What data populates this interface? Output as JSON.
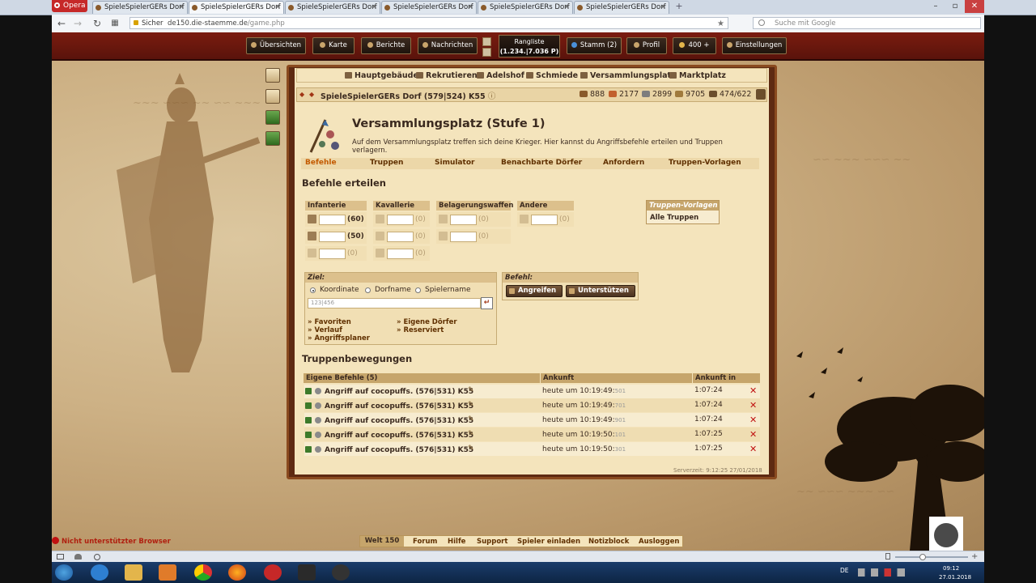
{
  "browser": {
    "opera_label": "Opera",
    "tabs": [
      {
        "title": "SpieleSpielerGERs Dorf ...",
        "active": false
      },
      {
        "title": "SpieleSpielerGERs Dorf ...",
        "active": true
      },
      {
        "title": "SpieleSpielerGERs Dorf ...",
        "active": false
      },
      {
        "title": "SpieleSpielerGERs Dorf ...",
        "active": false
      },
      {
        "title": "SpieleSpielerGERs Dorf ...",
        "active": false
      },
      {
        "title": "SpieleSpielerGERs Dorf ...",
        "active": false
      }
    ],
    "secure_label": "Sicher",
    "url_domain": "de150.die-staemme.de",
    "url_path": "/game.php",
    "search_placeholder": "Suche mit Google",
    "new_tab": "+"
  },
  "topmenu": {
    "uebersichten": "Übersichten",
    "karte": "Karte",
    "berichte": "Berichte",
    "nachrichten": "Nachrichten",
    "rangliste_label": "Rangliste",
    "rangliste_value": "(1.234.|7.036 P)",
    "stamm": "Stamm (2)",
    "profil": "Profil",
    "premium": "400 +",
    "einstellungen": "Einstellungen"
  },
  "buildings": {
    "hauptgebaeude": "Hauptgebäude",
    "rekrutieren": "Rekrutieren",
    "adelshof": "Adelshof",
    "schmiede": "Schmiede",
    "versammlungsplatz": "Versammlungsplatz",
    "marktplatz": "Marktplatz"
  },
  "village": {
    "name": "SpieleSpielerGERs Dorf (579|524) K55",
    "wood": "888",
    "clay": "2177",
    "iron": "2899",
    "storage": "9705",
    "population": "474/622"
  },
  "page": {
    "title": "Versammlungsplatz (Stufe 1)",
    "description": "Auf dem Versammlungsplatz treffen sich deine Krieger. Hier kannst du Angriffsbefehle erteilen und Truppen verlagern.",
    "subtabs": [
      "Befehle",
      "Truppen",
      "Simulator",
      "Benachbarte Dörfer",
      "Anfordern",
      "Truppen-Vorlagen"
    ],
    "selected_subtab": "Befehle",
    "befehle_heading": "Befehle erteilen"
  },
  "units": {
    "infanterie": "Infanterie",
    "kavallerie": "Kavallerie",
    "belagerung": "Belagerungswaffen",
    "andere": "Andere",
    "inf": [
      {
        "icon": "spear-icon",
        "count": "(60)",
        "available": true
      },
      {
        "icon": "sword-icon",
        "count": "(50)",
        "available": true
      },
      {
        "icon": "axe-icon",
        "count": "(0)",
        "available": false
      }
    ],
    "kav": [
      {
        "icon": "scout-icon",
        "count": "(0)"
      },
      {
        "icon": "light-cavalry-icon",
        "count": "(0)"
      },
      {
        "icon": "heavy-cavalry-icon",
        "count": "(0)"
      }
    ],
    "bel": [
      {
        "icon": "ram-icon",
        "count": "(0)"
      },
      {
        "icon": "catapult-icon",
        "count": "(0)"
      }
    ],
    "and": [
      {
        "icon": "noble-icon",
        "count": "(0)"
      }
    ]
  },
  "templates": {
    "head": "Truppen-Vorlagen",
    "all": "Alle Truppen"
  },
  "ziel": {
    "head": "Ziel:",
    "opt_coord": "Koordinate",
    "opt_village": "Dorfname",
    "opt_player": "Spielername",
    "input_placeholder": "123|456",
    "link_favoriten": "» Favoriten",
    "link_verlauf": "» Verlauf",
    "link_angriffsplaner": "» Angriffsplaner",
    "link_eigene": "» Eigene Dörfer",
    "link_reserviert": "» Reserviert"
  },
  "befehl": {
    "head": "Befehl:",
    "attack": "Angreifen",
    "support": "Unterstützen"
  },
  "movements": {
    "heading": "Truppenbewegungen",
    "col_own": "Eigene Befehle (5)",
    "col_arrival": "Ankunft",
    "col_in": "Ankunft in",
    "rows": [
      {
        "cmd": "Angriff auf cocopuffs. (576|531) K55",
        "arrival": "heute um 10:19:49:",
        "ms": "501",
        "in": "1:07:24"
      },
      {
        "cmd": "Angriff auf cocopuffs. (576|531) K55",
        "arrival": "heute um 10:19:49:",
        "ms": "701",
        "in": "1:07:24"
      },
      {
        "cmd": "Angriff auf cocopuffs. (576|531) K55",
        "arrival": "heute um 10:19:49:",
        "ms": "901",
        "in": "1:07:24"
      },
      {
        "cmd": "Angriff auf cocopuffs. (576|531) K55",
        "arrival": "heute um 10:19:50:",
        "ms": "101",
        "in": "1:07:25"
      },
      {
        "cmd": "Angriff auf cocopuffs. (576|531) K55",
        "arrival": "heute um 10:19:50:",
        "ms": "301",
        "in": "1:07:25"
      }
    ]
  },
  "servertime": "Serverzeit: 9:12:25 27/01/2018",
  "bottom": {
    "unsupported": "Nicht unterstützter Browser",
    "welt": "Welt 150",
    "links": [
      "Forum",
      "Hilfe",
      "Support",
      "Spieler einladen",
      "Notizblock",
      "Ausloggen"
    ]
  },
  "taskbar": {
    "lang": "DE",
    "time": "09:12",
    "date": "27.01.2018"
  }
}
